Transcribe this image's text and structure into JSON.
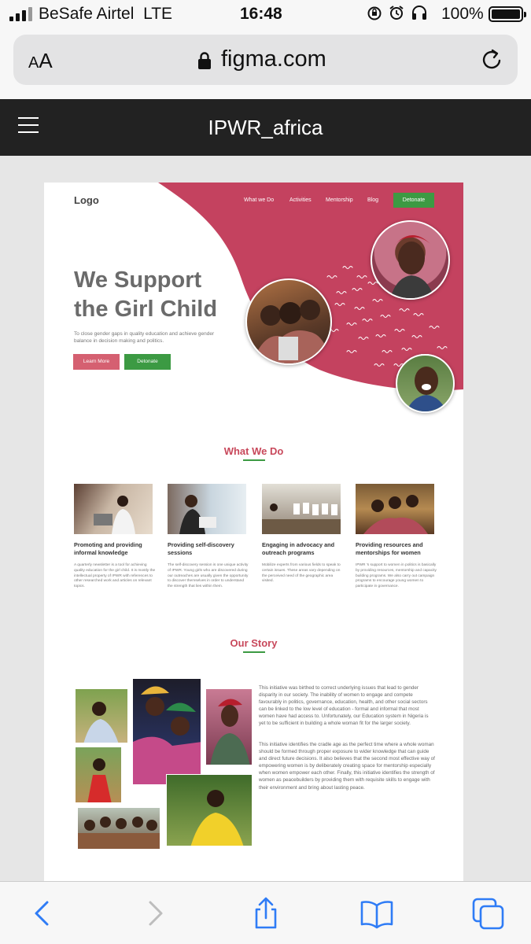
{
  "status": {
    "carrier": "BeSafe Airtel",
    "network": "LTE",
    "time": "16:48",
    "battery": "100%"
  },
  "browser": {
    "aa_small": "A",
    "aa_big": "A",
    "domain": "figma.com"
  },
  "figma": {
    "file_title": "IPWR_africa"
  },
  "site": {
    "logo": "Logo",
    "nav": [
      "What we Do",
      "Activities",
      "Mentorship",
      "Blog"
    ],
    "nav_button": "Detonate",
    "hero": {
      "title_line1": "We Support",
      "title_line2": "the Girl Child",
      "subtitle": "To close gender gaps in quality education and achieve gender balance in decision making and politics.",
      "learn_more": "Learn More",
      "donate": "Detonate"
    },
    "what_we_do": {
      "heading": "What We Do",
      "cards": [
        {
          "title": "Promoting and providing informal knowledge",
          "text": "A quarterly newsletter is a tool for achieving quality education for the girl child. It is mostly the intellectual property of IPWR with references to other researched work and articles on relevant topics."
        },
        {
          "title": "Providing self-discovery sessions",
          "text": "The self-discovery session is one unique activity of IPWR. Young girls who are discovered during our outreaches are usually given the opportunity to discover themselves in order to understand the strength that lies within them."
        },
        {
          "title": "Engaging in advocacy and outreach programs",
          "text": "Mobilize experts from various fields to speak to certain issues. These areas vary depending on the perceived need of the geographic area visited."
        },
        {
          "title": "Providing resources and mentorships for women",
          "text": "IPWR 's support to women in politics is basically by providing resources, mentorship and capacity building programs. We also carry out campaign programs to encourage young women to participate in governance."
        }
      ]
    },
    "our_story": {
      "heading": "Our Story",
      "paragraph1": "This initiative was birthed to correct underlying issues that lead to gender disparity in our society. The inability of women to engage and compete favourably in politics, governance, education, health, and other social sectors can be linked to the low level of education - formal and informal that most women have had access to. Unfortunately, our Education system in Nigeria is yet to be sufficient in building a whole woman fit for the larger society.",
      "paragraph2": "This initiative identifies the cradle age as the perfect time where a whole woman should be formed through proper exposure to wider knowledge that can guide and direct future decisions. It also believes that the second most effective way of empowering women is by deliberately creating space for mentorship especially when women empower each other. Finally, this initiative identifies the strength of women as peacebuilders by providing them with requisite skills to engage with their environment and bring about lasting peace."
    }
  },
  "colors": {
    "brand_pink": "#c4425f",
    "brand_green": "#3c9a43",
    "figma_bar": "#222222",
    "ios_blue": "#2f7cf6"
  },
  "toolbar": {
    "icons": [
      "back-icon",
      "forward-icon",
      "share-icon",
      "bookmarks-icon",
      "tabs-icon"
    ]
  }
}
